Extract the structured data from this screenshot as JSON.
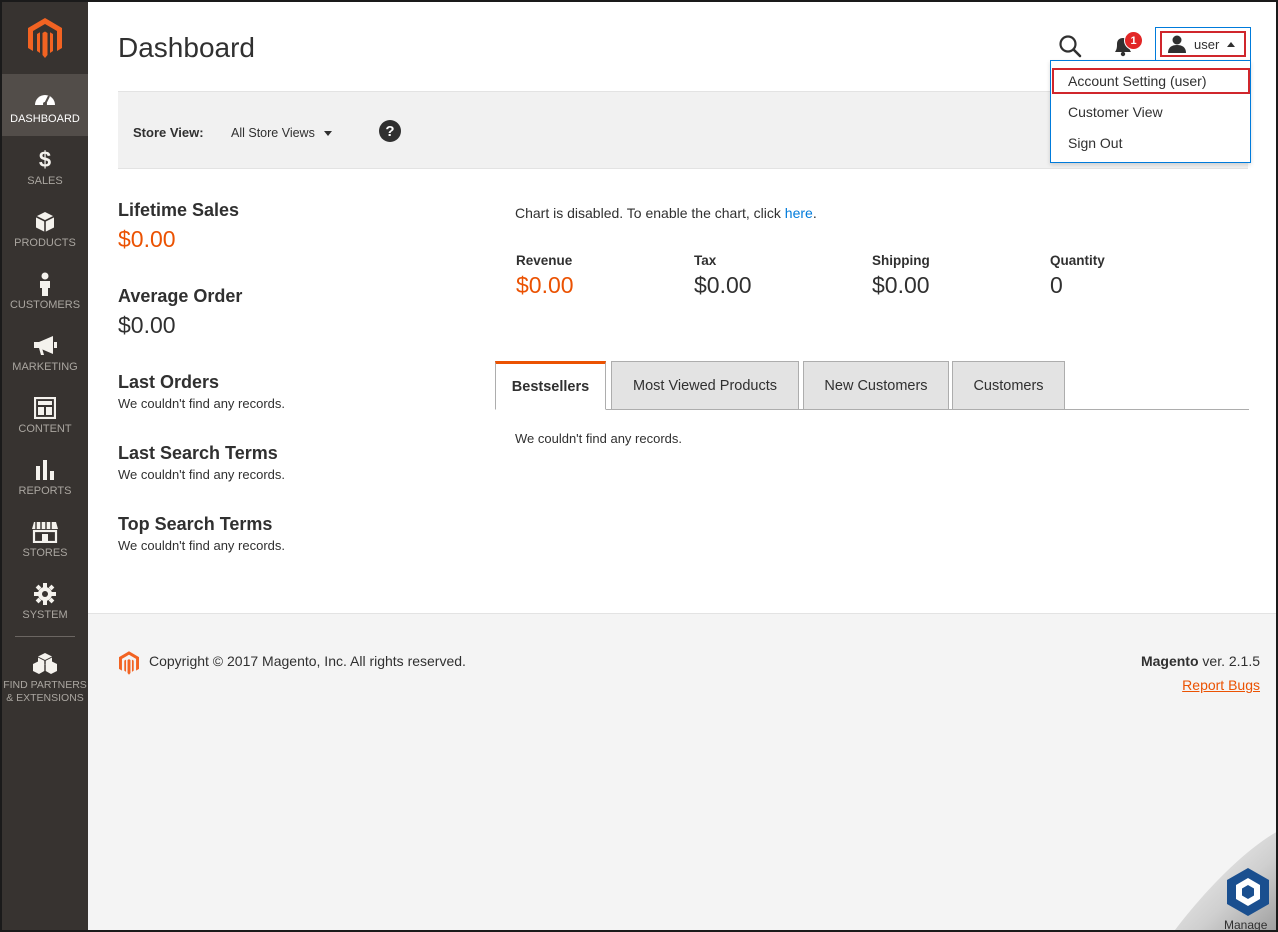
{
  "sidebar": {
    "items": [
      {
        "label": "DASHBOARD"
      },
      {
        "label": "SALES"
      },
      {
        "label": "PRODUCTS"
      },
      {
        "label": "CUSTOMERS"
      },
      {
        "label": "MARKETING"
      },
      {
        "label": "CONTENT"
      },
      {
        "label": "REPORTS"
      },
      {
        "label": "STORES"
      },
      {
        "label": "SYSTEM"
      },
      {
        "label_line1": "FIND PARTNERS",
        "label_line2": "& EXTENSIONS"
      }
    ]
  },
  "header": {
    "title": "Dashboard",
    "notification_count": "1",
    "user_name": "user",
    "user_menu": [
      "Account Setting (user)",
      "Customer View",
      "Sign Out"
    ]
  },
  "store_view": {
    "label": "Store View:",
    "value": "All Store Views",
    "help": "?"
  },
  "stats": {
    "lifetime_sales": {
      "label": "Lifetime Sales",
      "value": "$0.00"
    },
    "average_order": {
      "label": "Average Order",
      "value": "$0.00"
    },
    "last_orders": {
      "label": "Last Orders",
      "empty": "We couldn't find any records."
    },
    "last_search_terms": {
      "label": "Last Search Terms",
      "empty": "We couldn't find any records."
    },
    "top_search_terms": {
      "label": "Top Search Terms",
      "empty": "We couldn't find any records."
    }
  },
  "chart": {
    "message": "Chart is disabled. To enable the chart, click ",
    "link": "here",
    "period": "."
  },
  "metrics": [
    {
      "label": "Revenue",
      "value": "$0.00"
    },
    {
      "label": "Tax",
      "value": "$0.00"
    },
    {
      "label": "Shipping",
      "value": "$0.00"
    },
    {
      "label": "Quantity",
      "value": "0"
    }
  ],
  "tabs": {
    "items": [
      "Bestsellers",
      "Most Viewed Products",
      "New Customers",
      "Customers"
    ],
    "empty": "We couldn't find any records."
  },
  "footer": {
    "copyright": "Copyright © 2017 Magento, Inc. All rights reserved.",
    "brand": "Magento",
    "version": " ver. 2.1.5",
    "report_bugs": "Report Bugs"
  },
  "corner_badge": {
    "label": "Manage"
  },
  "colors": {
    "sidebar_bg": "#373330",
    "accent_orange": "#eb5202",
    "link_blue": "#007bdb",
    "highlight_red": "#d0262c"
  }
}
